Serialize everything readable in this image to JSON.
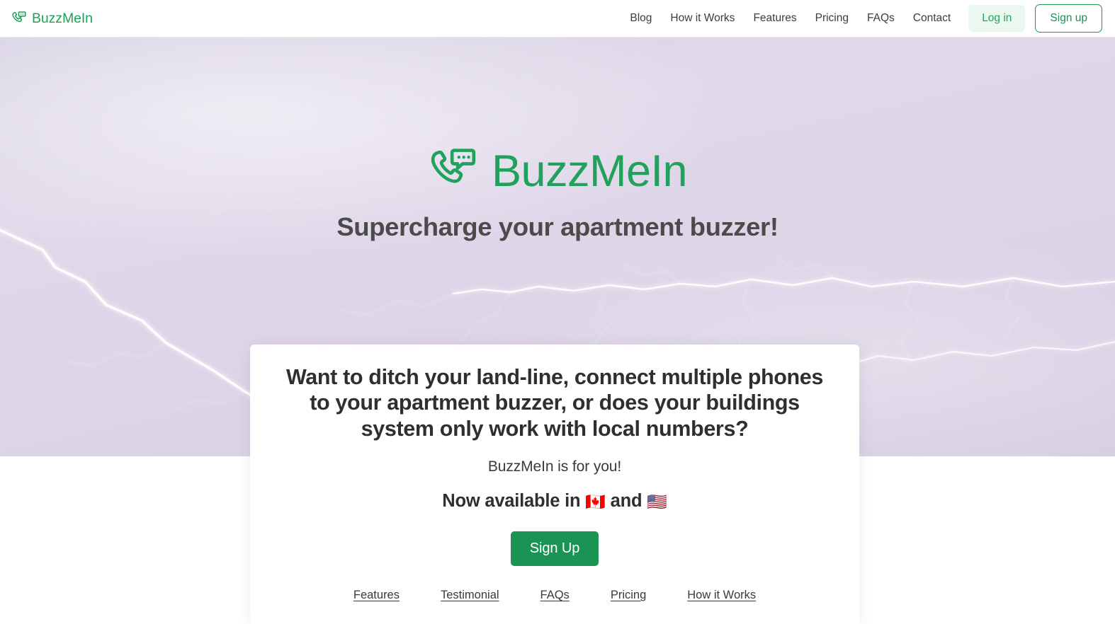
{
  "colors": {
    "brand_green": "#22a05a",
    "button_green": "#1a9355",
    "login_bg": "#eaf8ef",
    "heading_dark": "#2f2f2f",
    "hero_lavender": "#d6d0e2"
  },
  "header": {
    "brand_name": "BuzzMeIn",
    "brand_icon": "phone-chat-icon",
    "nav": [
      {
        "label": "Blog"
      },
      {
        "label": "How it Works"
      },
      {
        "label": "Features"
      },
      {
        "label": "Pricing"
      },
      {
        "label": "FAQs"
      },
      {
        "label": "Contact"
      }
    ],
    "login_label": "Log in",
    "signup_label": "Sign up"
  },
  "hero": {
    "logo_icon": "phone-chat-icon",
    "logo_text": "BuzzMeIn",
    "tagline": "Supercharge your apartment buzzer!",
    "background": "lightning-storm-photo"
  },
  "card": {
    "heading": "Want to ditch your land-line, connect multiple phones to your apartment buzzer, or does your buildings system only work with local numbers?",
    "subheading": "BuzzMeIn is for you!",
    "availability_prefix": "Now available in",
    "availability_flag_1": "🇨🇦",
    "availability_joiner": "and",
    "availability_flag_2": "🇺🇸",
    "cta_label": "Sign Up",
    "links": [
      {
        "label": "Features"
      },
      {
        "label": "Testimonial"
      },
      {
        "label": "FAQs"
      },
      {
        "label": "Pricing"
      },
      {
        "label": "How it Works"
      }
    ]
  }
}
